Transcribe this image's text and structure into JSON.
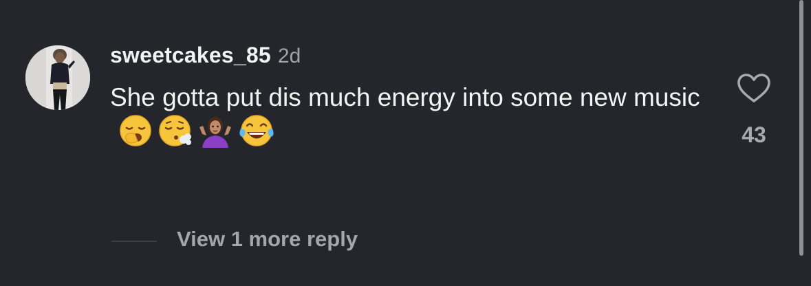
{
  "comment": {
    "username": "sweetcakes_85",
    "timestamp": "2d",
    "text": "She gotta put dis much energy into some new music",
    "emojis": [
      "yawning-face",
      "face-exhaling",
      "person-shrugging",
      "face-with-tears-of-joy"
    ],
    "likes": "43"
  },
  "replies": {
    "view_more_label": "View 1 more reply"
  },
  "icons": {
    "like": "heart-outline-icon"
  },
  "colors": {
    "background": "#24262c",
    "primary_text": "#f4f4f4",
    "secondary_text": "#a3a6ad"
  }
}
